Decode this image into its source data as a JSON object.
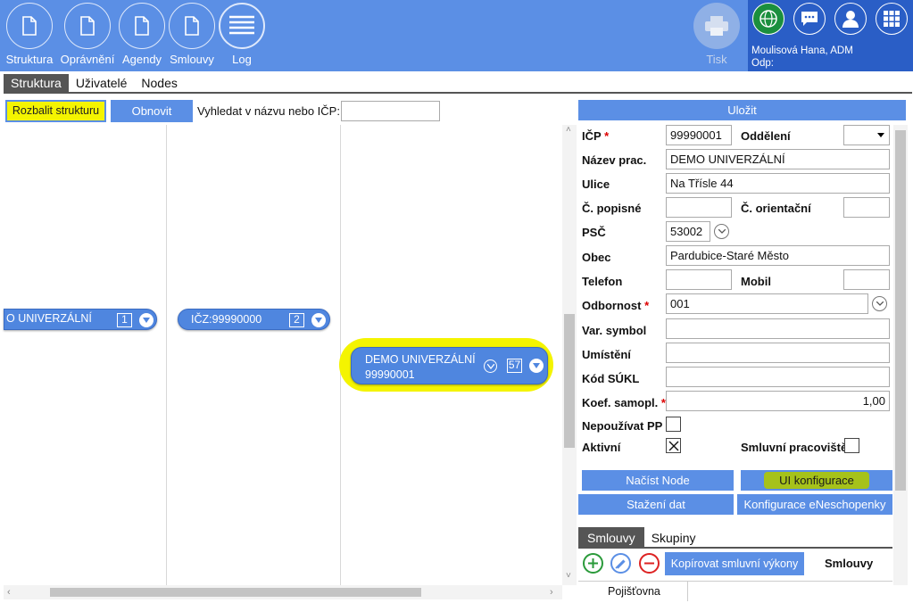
{
  "toolbar": {
    "buttons": [
      {
        "label": "Struktura",
        "icon": "document-icon"
      },
      {
        "label": "Oprávnění",
        "icon": "document-icon"
      },
      {
        "label": "Agendy",
        "icon": "document-icon"
      },
      {
        "label": "Smlouvy",
        "icon": "document-icon"
      },
      {
        "label": "Log",
        "icon": "lines-icon"
      }
    ],
    "print_label": "Tisk"
  },
  "user": {
    "name": "Moulisová Hana, ADM",
    "odp": "Odp:",
    "icons": [
      "globe-icon",
      "chat-icon",
      "user-icon",
      "grid-icon"
    ]
  },
  "tabs": [
    {
      "label": "Struktura",
      "active": true
    },
    {
      "label": "Uživatelé",
      "active": false
    },
    {
      "label": "Nodes",
      "active": false
    }
  ],
  "tree_toolbar": {
    "expand_label": "Rozbalit strukturu",
    "refresh_label": "Obnovit",
    "search_label": "Vyhledat v názvu nebo IČP:",
    "search_value": ""
  },
  "tree": {
    "nodes": [
      {
        "text": "O UNIVERZÁLNÍ",
        "count": "1"
      },
      {
        "text": "IČZ:99990000",
        "count": "2"
      },
      {
        "text": "DEMO UNIVERZÁLNÍ",
        "text2": "99990001",
        "count": "57"
      }
    ]
  },
  "form": {
    "save_label": "Uložit",
    "labels": {
      "icp": "IČP",
      "oddeleni": "Oddělení",
      "nazev": "Název prac.",
      "ulice": "Ulice",
      "cpopisne": "Č. popisné",
      "corientacni": "Č. orientační",
      "psc": "PSČ",
      "obec": "Obec",
      "telefon": "Telefon",
      "mobil": "Mobil",
      "odbornost": "Odbornost",
      "varsymbol": "Var. symbol",
      "umisteni": "Umístění",
      "kodsukl": "Kód SÚKL",
      "koef": "Koef. samopl.",
      "nepouzivat": "Nepoužívat PP",
      "aktivni": "Aktivní",
      "smluvni": "Smluvní pracoviště"
    },
    "values": {
      "icp": "99990001",
      "oddeleni": "",
      "nazev": "DEMO UNIVERZÁLNÍ",
      "ulice": "Na Třísle 44",
      "cpopisne": "",
      "corientacni": "",
      "psc": "53002",
      "obec": "Pardubice-Staré Město",
      "telefon": "",
      "mobil": "",
      "odbornost": "001",
      "varsymbol": "",
      "umisteni": "",
      "kodsukl": "",
      "koef": "1,00"
    },
    "checks": {
      "nepouzivat": false,
      "aktivni": true,
      "smluvni": false
    },
    "buttons": {
      "nacist": "Načíst Node",
      "uikonf": "UI konfigurace",
      "stazeni": "Stažení dat",
      "eneschopenky": "Konfigurace eNeschopenky"
    }
  },
  "subtabs": [
    {
      "label": "Smlouvy",
      "active": true
    },
    {
      "label": "Skupiny",
      "active": false
    }
  ],
  "contracts": {
    "copy_label": "Kopírovat smluvní výkony",
    "header": "Smlouvy",
    "col_label": "Pojišťovna"
  }
}
